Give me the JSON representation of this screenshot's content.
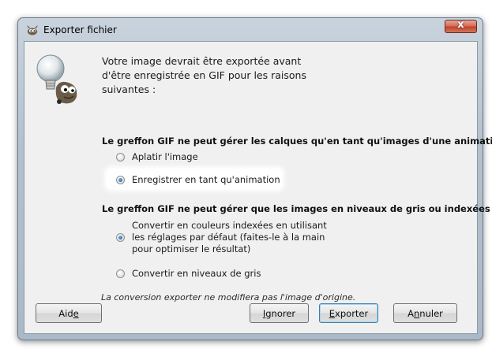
{
  "window": {
    "title": "Exporter fichier",
    "close_glyph": "x"
  },
  "intro_text": "Votre image devrait être exportée avant\nd'être enregistrée en GIF pour les raisons\nsuivantes :",
  "section_layers": {
    "heading": "Le greffon GIF ne peut gérer les calques qu'en tant qu'images d'une animation",
    "options": [
      {
        "label": "Aplatir l'image",
        "checked": false
      },
      {
        "label": "Enregistrer en tant qu'animation",
        "checked": true
      }
    ]
  },
  "section_color": {
    "heading": "Le greffon GIF ne peut gérer que les images en niveaux de gris ou indexées",
    "options": [
      {
        "label": "Convertir en couleurs indexées en utilisant\nles réglages par défaut (faites-le à la main\npour optimiser le résultat)",
        "checked": true
      },
      {
        "label": "Convertir en niveaux de gris",
        "checked": false
      }
    ]
  },
  "note": "La conversion exporter ne modifiera pas l'image d'origine.",
  "buttons": {
    "help": {
      "pre": "Aid",
      "u": "e",
      "post": ""
    },
    "ignore": {
      "pre": "",
      "u": "I",
      "post": "gnorer"
    },
    "export": {
      "pre": "",
      "u": "E",
      "post": "xporter"
    },
    "cancel": {
      "pre": "A",
      "u": "n",
      "post": "nuler"
    }
  },
  "icons": {
    "app": "gimp-wilber-icon",
    "mascot": "wilber-lightbulb-icon"
  }
}
